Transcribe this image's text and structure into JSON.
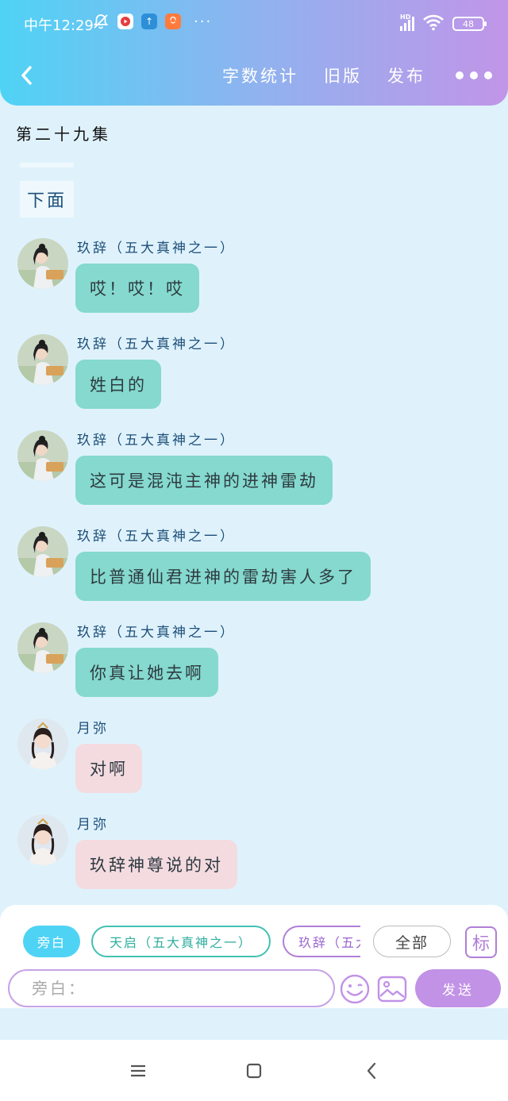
{
  "status_bar": {
    "time": "中午12:29",
    "more": "···",
    "network": "HD",
    "battery": "48"
  },
  "header": {
    "nav_links": [
      "字数统计",
      "旧版",
      "发布"
    ]
  },
  "content": {
    "episode_title": "第二十九集",
    "section_label": "下面",
    "messages": [
      {
        "speaker": "玖辞（五大真神之一）",
        "text": "哎！哎！哎",
        "style": "teal",
        "avatar": "jiuci-avatar"
      },
      {
        "speaker": "玖辞（五大真神之一）",
        "text": "姓白的",
        "style": "teal",
        "avatar": "jiuci-avatar"
      },
      {
        "speaker": "玖辞（五大真神之一）",
        "text": "这可是混沌主神的进神雷劫",
        "style": "teal",
        "avatar": "jiuci-avatar"
      },
      {
        "speaker": "玖辞（五大真神之一）",
        "text": "比普通仙君进神的雷劫害人多了",
        "style": "teal",
        "avatar": "jiuci-avatar"
      },
      {
        "speaker": "玖辞（五大真神之一）",
        "text": "你真让她去啊",
        "style": "teal",
        "avatar": "jiuci-avatar"
      },
      {
        "speaker": "月弥",
        "text": "对啊",
        "style": "pink",
        "avatar": "yuemi-avatar"
      },
      {
        "speaker": "月弥",
        "text": "玖辞神尊说的对",
        "style": "pink",
        "avatar": "yuemi-avatar"
      }
    ]
  },
  "composer": {
    "chips": [
      "旁白",
      "天启（五大真神之一）",
      "玖辞（五大",
      "全部"
    ],
    "mark_label": "标",
    "input_placeholder": "旁白：",
    "send_label": "发送"
  },
  "colors": {
    "header_start": "#4fd3f5",
    "header_end": "#c195e8",
    "bubble_teal": "#85d9cf",
    "bubble_pink": "#f3dbe0",
    "send_button": "#c192e6"
  }
}
